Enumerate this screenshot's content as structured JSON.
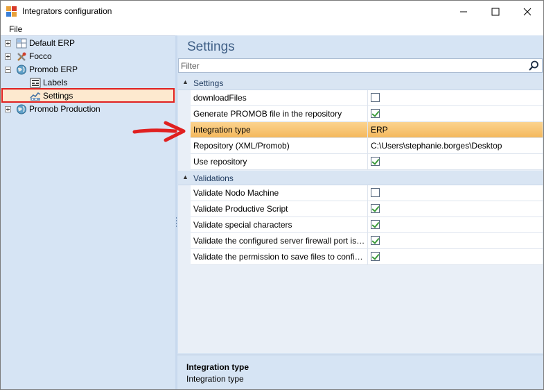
{
  "window": {
    "title": "Integrators configuration",
    "minimize": "—",
    "maximize": "☐",
    "close": "✕"
  },
  "menu": {
    "file": "File"
  },
  "tree": {
    "items": [
      {
        "label": "Default ERP",
        "icon": "grid-icon"
      },
      {
        "label": "Focco",
        "icon": "tools-icon"
      },
      {
        "label": "Promob ERP",
        "icon": "globe-icon"
      },
      {
        "label": "Labels",
        "icon": "labels-icon"
      },
      {
        "label": "Settings",
        "icon": "settings-chart-icon"
      },
      {
        "label": "Promob Production",
        "icon": "globe-icon"
      }
    ]
  },
  "panel": {
    "title": "Settings",
    "filter_placeholder": "Filter"
  },
  "categories": {
    "settings": "Settings",
    "validations": "Validations"
  },
  "settings_props": [
    {
      "name": "downloadFiles",
      "type": "checkbox",
      "checked": false
    },
    {
      "name": "Generate PROMOB file in the repository",
      "type": "checkbox",
      "checked": true
    },
    {
      "name": "Integration type",
      "type": "text",
      "value": "ERP"
    },
    {
      "name": "Repository (XML/Promob)",
      "type": "text",
      "value": "C:\\Users\\stephanie.borges\\Desktop"
    },
    {
      "name": "Use repository",
      "type": "checkbox",
      "checked": true
    }
  ],
  "validation_props": [
    {
      "name": "Validate Nodo Machine",
      "type": "checkbox",
      "checked": false
    },
    {
      "name": "Validate Productive Script",
      "type": "checkbox",
      "checked": true
    },
    {
      "name": "Validate special characters",
      "type": "checkbox",
      "checked": true
    },
    {
      "name": "Validate the configured server firewall port is op...",
      "type": "checkbox",
      "checked": true
    },
    {
      "name": "Validate the permission to save files to configure...",
      "type": "checkbox",
      "checked": true
    }
  ],
  "description": {
    "title": "Integration type",
    "text": "Integration type"
  },
  "colors": {
    "accent_selected": "#f4b85c",
    "panel_bg": "#d6e4f4",
    "annotation_red": "#e02020"
  }
}
